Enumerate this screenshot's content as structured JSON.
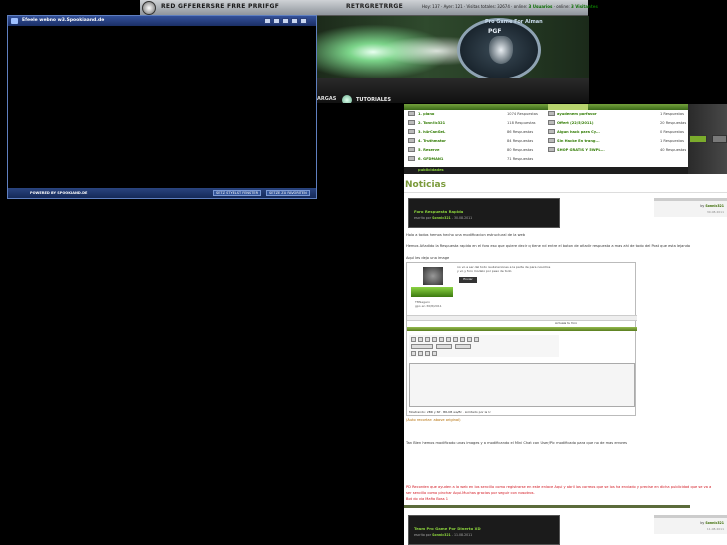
{
  "topbar": {
    "site_name": "RED GFFERERSRE FRRE PRRIFGF",
    "link": "RETRGRETRRGE",
    "stats_prefix": "Hoy: 137 · Ayer: 121 · Visitas totales: 32674 · online:",
    "stats_online": "3 Usuarios",
    "stats_mid": "· online:",
    "stats_guests": "3 Visitantes"
  },
  "banner": {
    "emblem_caption": "Pro Game For Alman",
    "emblem_tag": "PGF",
    "nav_item_1": "ARGAS",
    "nav_item_2": "TUTORIALES"
  },
  "chat": {
    "title": "Efeele webno w3.Spookiaand.de",
    "powered": "POWERED BY SPOOKIAND.DE",
    "footer_btn_1": "SETZ STYELST FENSTER",
    "footer_btn_2": "SETZE ZU FAVORITEN"
  },
  "forum": {
    "rows": [
      {
        "title": "1. piano",
        "replies": "1074 Respuestas",
        "right_title": "ayudenem porfavor",
        "right_replies": "1 Respuestas"
      },
      {
        "title": "2. Tonn!ic321",
        "replies": "118 Respuestas",
        "right_title": "Offert (22/5/2011)",
        "right_replies": "20 Respuestas"
      },
      {
        "title": "3. h4rCanGeL",
        "replies": "86 Respuestas",
        "right_title": "Algun hack para Cy...",
        "right_replies": "0 Respuestas"
      },
      {
        "title": "4. Truthmator",
        "replies": "84 Respuestas",
        "right_title": "Sin Hacke En trang...",
        "right_replies": "1 Respuestas"
      },
      {
        "title": "5. Reserve",
        "replies": "80 Respuestas",
        "right_title": "SHOP GRATIS Y 5WPL...",
        "right_replies": "40 Respuestas"
      },
      {
        "title": "6. GFDMAN1",
        "replies": "71 Respuestas",
        "right_title": "",
        "right_replies": ""
      }
    ],
    "footer_title": "publicidades"
  },
  "news": {
    "section_title": "Noticias",
    "posts": [
      {
        "title": "Foro Respuesta Rapida",
        "meta_prefix": "escrito por",
        "author": "Sonnic321",
        "date": "- 30.08.2011",
        "side_by_prefix": "by",
        "side_by": "Sonnic321",
        "side_date": "30.08.2011"
      },
      {
        "title": "Team Pro Game Por Dinerto XD",
        "meta_prefix": "escrito por",
        "author": "Sonnic321",
        "date": "- 11.08.2011",
        "side_by_prefix": "by",
        "side_by": "Sonnic321",
        "side_date": "11.08.2011"
      }
    ],
    "paragraphs": {
      "p1": "Hola a todos hemos hecho una modificacion estructural de la web",
      "p2": "Hemos Añadido la Respuesta rapida en el foro eso que quiere decir q tiene nd entre el boton de añadir respuesta a mas ahi de todo del Post que esta lejando",
      "p3": "Aquí les dejo una image",
      "p4": "(Auto recortar: above original)",
      "p5": "Tan Bien hemos modificado unas images y a modificando el Mini Chat con User/Pic modificado para que no de mas errores",
      "p6": "PD Recorden que ayuden a la web en los sencillo como registrarse en este enlace Aqui y abril los correos que se los ha enviado y precise en dicha publicidad que se va a",
      "p7": "ser sencillo como pinchar Aqui.Muchas gracias por seguir con nosotros.",
      "p8": "Bot do via Mafia Boss 1"
    },
    "shot": {
      "message_line_1": "no vo a ser del todo reubicaciones a la parte de para nosotros",
      "message_line_2": "y vo y foro modelo por peso de todo",
      "send_label": "Enviar",
      "user_line_1": "TMSegero",
      "user_line_2": "gpo en 30/8/2011",
      "search_label": "Actuala tu foro",
      "status_line": "Mostrando: 2BR y 6P · BR-KB wa/Br · Limitado por la U"
    }
  },
  "colors": {
    "accent_green": "#7a9a3a",
    "link_green": "#2f7a00",
    "chat_blue": "#32509a",
    "alert_red": "#d2141e"
  }
}
